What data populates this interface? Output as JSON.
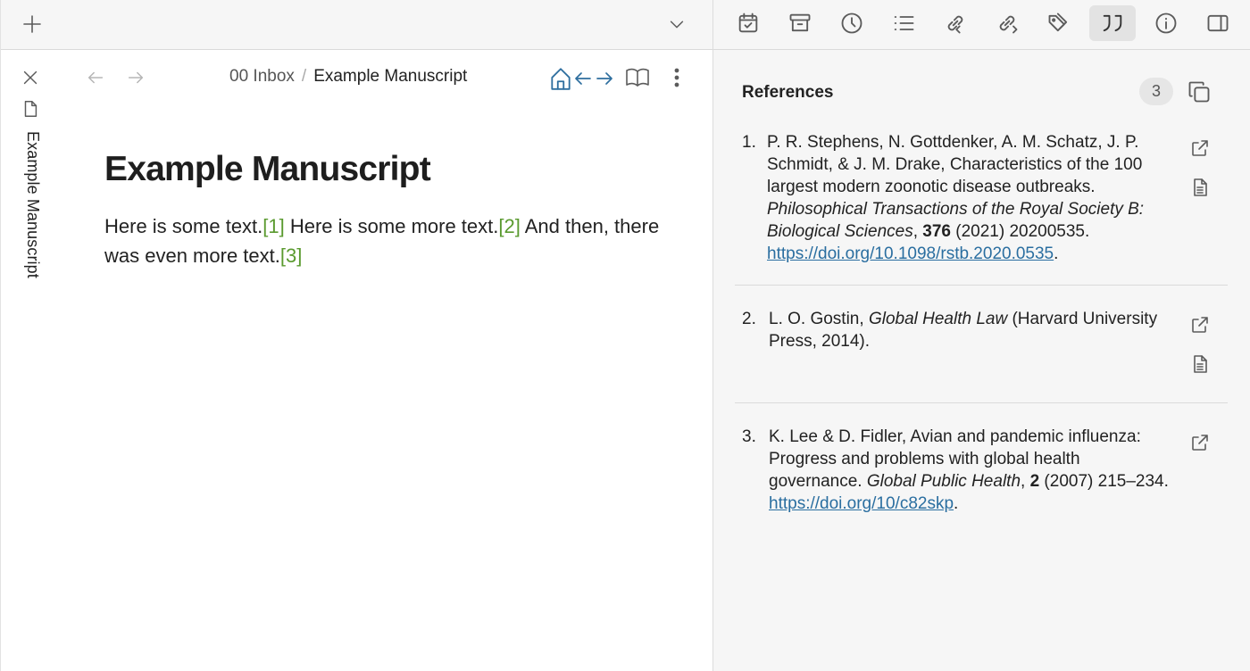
{
  "left_header": {
    "new_tab_icon": "plus-icon",
    "tab_list_icon": "chevron-down-icon"
  },
  "tab": {
    "title": "Example Manuscript",
    "close_icon": "close-icon",
    "file_icon": "file-icon"
  },
  "breadcrumb": {
    "folder": "00 Inbox",
    "separator": "/",
    "title": "Example Manuscript"
  },
  "document": {
    "title": "Example Manuscript",
    "segments": [
      {
        "text": "Here is some text.",
        "cite": false
      },
      {
        "text": "[1]",
        "cite": true
      },
      {
        "text": " Here is some more text.",
        "cite": false
      },
      {
        "text": "[2]",
        "cite": true
      },
      {
        "text": " And then, there was even more text.",
        "cite": false
      },
      {
        "text": "[3]",
        "cite": true
      }
    ]
  },
  "right_toolbar": {
    "icons": [
      "calendar-check-icon",
      "archive-icon",
      "clock-icon",
      "list-icon",
      "link-in-icon",
      "link-out-icon",
      "tags-icon",
      "quote-icon",
      "info-icon",
      "sidebar-icon"
    ],
    "active": "quote-icon"
  },
  "references": {
    "title": "References",
    "count": "3",
    "items": [
      {
        "num": "1.",
        "parts": [
          {
            "t": "P. R. Stephens, N. Gottdenker, A. M. Schatz, J. P. Schmidt, & J. M. Drake, Characteristics of the 100 largest modern zoonotic disease outbreaks. "
          },
          {
            "t": "Philosophical Transactions of the Royal Society B: Biological Sciences",
            "i": true
          },
          {
            "t": ", "
          },
          {
            "t": "376",
            "b": true
          },
          {
            "t": " (2021) 20200535. "
          },
          {
            "t": "https://doi.org/10.1098/rstb.2020.0535",
            "link": true
          },
          {
            "t": "."
          }
        ],
        "buttons": [
          "external-link-icon",
          "document-icon"
        ]
      },
      {
        "num": "2.",
        "parts": [
          {
            "t": "L. O. Gostin, "
          },
          {
            "t": "Global Health Law",
            "i": true
          },
          {
            "t": " (Harvard University Press, 2014)."
          }
        ],
        "buttons": [
          "external-link-icon",
          "document-icon"
        ]
      },
      {
        "num": "3.",
        "parts": [
          {
            "t": "K. Lee & D. Fidler, Avian and pandemic influenza: Progress and problems with global health governance. "
          },
          {
            "t": "Global Public Health",
            "i": true
          },
          {
            "t": ", "
          },
          {
            "t": "2",
            "b": true
          },
          {
            "t": " (2007) 215–234. "
          },
          {
            "t": "https://doi.org/10/c82skp",
            "link": true
          },
          {
            "t": "."
          }
        ],
        "buttons": [
          "external-link-icon"
        ]
      }
    ]
  },
  "colors": {
    "citation": "#5a9a2f",
    "link": "#2a6ea0",
    "pane_nav": "#2f6f9f"
  }
}
